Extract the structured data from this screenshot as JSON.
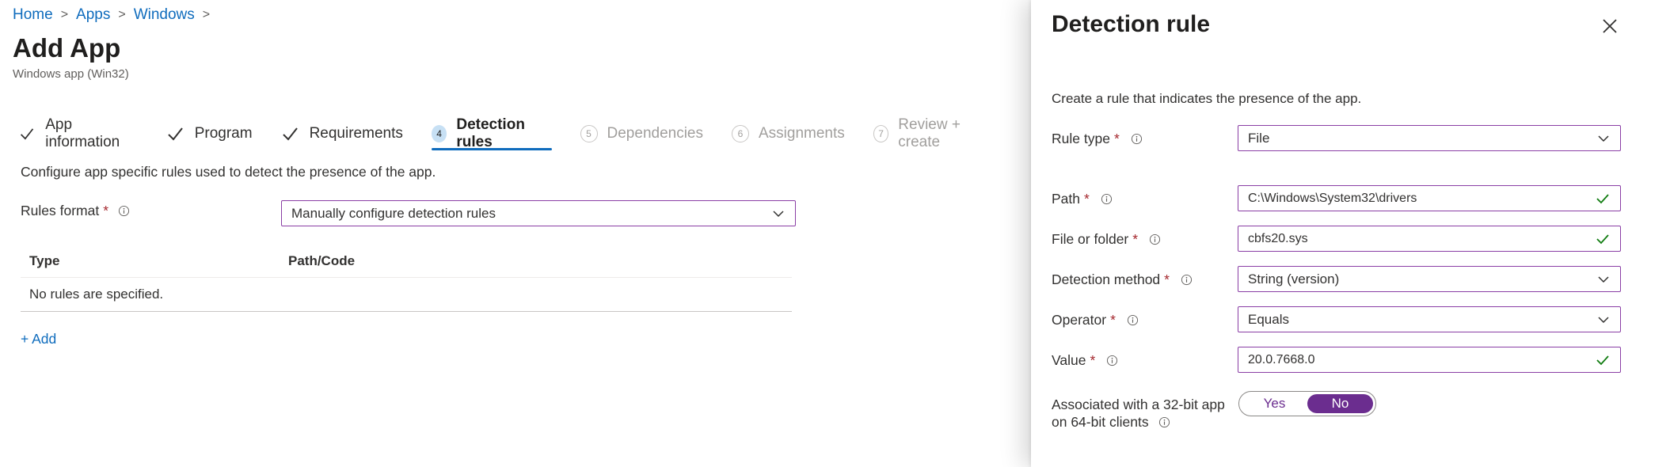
{
  "breadcrumb": [
    "Home",
    "Apps",
    "Windows"
  ],
  "page": {
    "title": "Add App",
    "subtitle": "Windows app (Win32)"
  },
  "steps": [
    {
      "label": "App information",
      "state": "done"
    },
    {
      "label": "Program",
      "state": "done"
    },
    {
      "label": "Requirements",
      "state": "done"
    },
    {
      "num": "4",
      "label": "Detection rules",
      "state": "active"
    },
    {
      "num": "5",
      "label": "Dependencies",
      "state": "disabled"
    },
    {
      "num": "6",
      "label": "Assignments",
      "state": "disabled"
    },
    {
      "num": "7",
      "label": "Review + create",
      "state": "disabled"
    }
  ],
  "main": {
    "description": "Configure app specific rules used to detect the presence of the app.",
    "rules_format_label": "Rules format",
    "rules_format_value": "Manually configure detection rules",
    "table": {
      "headers": [
        "Type",
        "Path/Code"
      ],
      "empty_text": "No rules are specified."
    },
    "add_label": "+ Add"
  },
  "panel": {
    "title": "Detection rule",
    "description": "Create a rule that indicates the presence of the app.",
    "rule_type": {
      "label": "Rule type",
      "value": "File"
    },
    "path": {
      "label": "Path",
      "value": "C:\\Windows\\System32\\drivers"
    },
    "file_or_folder": {
      "label": "File or folder",
      "value": "cbfs20.sys"
    },
    "detection_method": {
      "label": "Detection method",
      "value": "String (version)"
    },
    "operator": {
      "label": "Operator",
      "value": "Equals"
    },
    "value": {
      "label": "Value",
      "value": "20.0.7668.0"
    },
    "associated": {
      "label_line1": "Associated with a 32-bit app",
      "label_line2": "on 64-bit clients",
      "options": [
        "Yes",
        "No"
      ],
      "selected": "No"
    }
  },
  "colors": {
    "link": "#0f6cbd",
    "accent_purple": "#6b2d8f",
    "input_border": "#8a3ea5",
    "valid_green": "#107c10",
    "required_red": "#a4262c"
  }
}
